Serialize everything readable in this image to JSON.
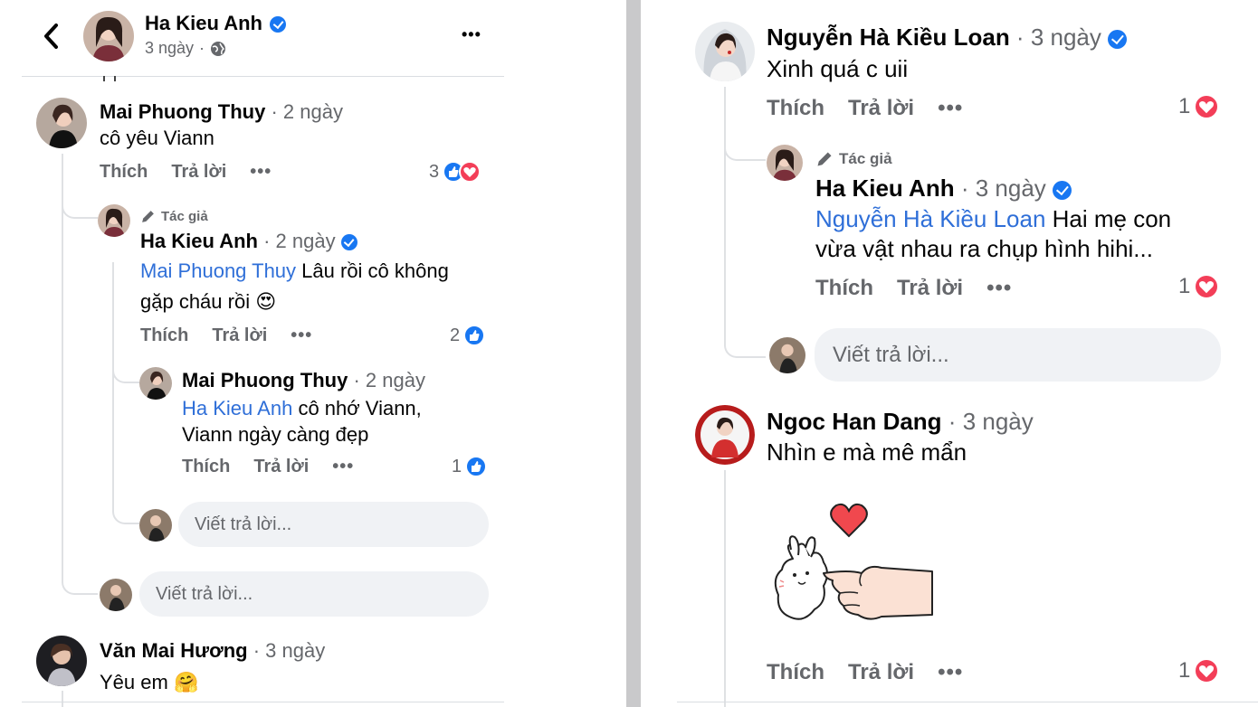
{
  "left": {
    "header": {
      "name": "Ha Kieu Anh",
      "time": "3 ngày",
      "more_label": "•••"
    },
    "comments": {
      "c1": {
        "name": "Mai Phuong Thuy",
        "time": "2 ngày",
        "text": "cô yêu Viann",
        "like_label": "Thích",
        "reply_label": "Trả lời",
        "more_label": "•••",
        "reactions": "3"
      },
      "r1": {
        "author_tag": "Tác giả",
        "name": "Ha Kieu Anh",
        "time": "2 ngày",
        "mention": "Mai Phuong Thuy",
        "text_line1": "Lâu rồi cô không",
        "text_line2": "gặp cháu rồi",
        "emoji": "😍",
        "like_label": "Thích",
        "reply_label": "Trả lời",
        "more_label": "•••",
        "reactions": "2"
      },
      "r2": {
        "name": "Mai Phuong Thuy",
        "time": "2 ngày",
        "mention": "Ha Kieu Anh",
        "text_line1": "cô nhớ Viann,",
        "text_line2": "Viann ngày càng đẹp",
        "like_label": "Thích",
        "reply_label": "Trả lời",
        "more_label": "•••",
        "reactions": "1"
      },
      "c2": {
        "name": "Văn Mai Hương",
        "time": "3 ngày",
        "text": "Yêu em",
        "emoji": "🤗"
      }
    },
    "reply_placeholder": "Viết trả lời..."
  },
  "right": {
    "comments": {
      "c1": {
        "name": "Nguyễn Hà Kiều Loan",
        "time": "3 ngày",
        "text": "Xinh quá c uii",
        "like_label": "Thích",
        "reply_label": "Trả lời",
        "more_label": "•••",
        "reactions": "1"
      },
      "r1": {
        "author_tag": "Tác giả",
        "name": "Ha Kieu Anh",
        "time": "3 ngày",
        "mention": "Nguyễn Hà Kiều Loan",
        "text_line1": "Hai mẹ con",
        "text_line2": "vừa vật nhau ra chụp hình hihi...",
        "like_label": "Thích",
        "reply_label": "Trả lời",
        "more_label": "•••",
        "reactions": "1"
      },
      "c2": {
        "name": "Ngoc Han Dang",
        "time": "3 ngày",
        "text": "Nhìn e mà mê mẩn",
        "like_label": "Thích",
        "reply_label": "Trả lời",
        "more_label": "•••",
        "reactions": "1"
      }
    },
    "reply_placeholder": "Viết trả lời..."
  },
  "colors": {
    "accent": "#1877f2",
    "mention": "#2f6fd8",
    "love": "#f33e58",
    "muted": "#65676b",
    "input_bg": "#f0f2f5",
    "divider": "#c9c9cb"
  },
  "icons": [
    "back-arrow-icon",
    "verified-badge-icon",
    "globe-icon",
    "more-icon",
    "pencil-icon",
    "like-reaction-icon",
    "love-reaction-icon",
    "heart-sticker",
    "bunny-poke-sticker"
  ]
}
